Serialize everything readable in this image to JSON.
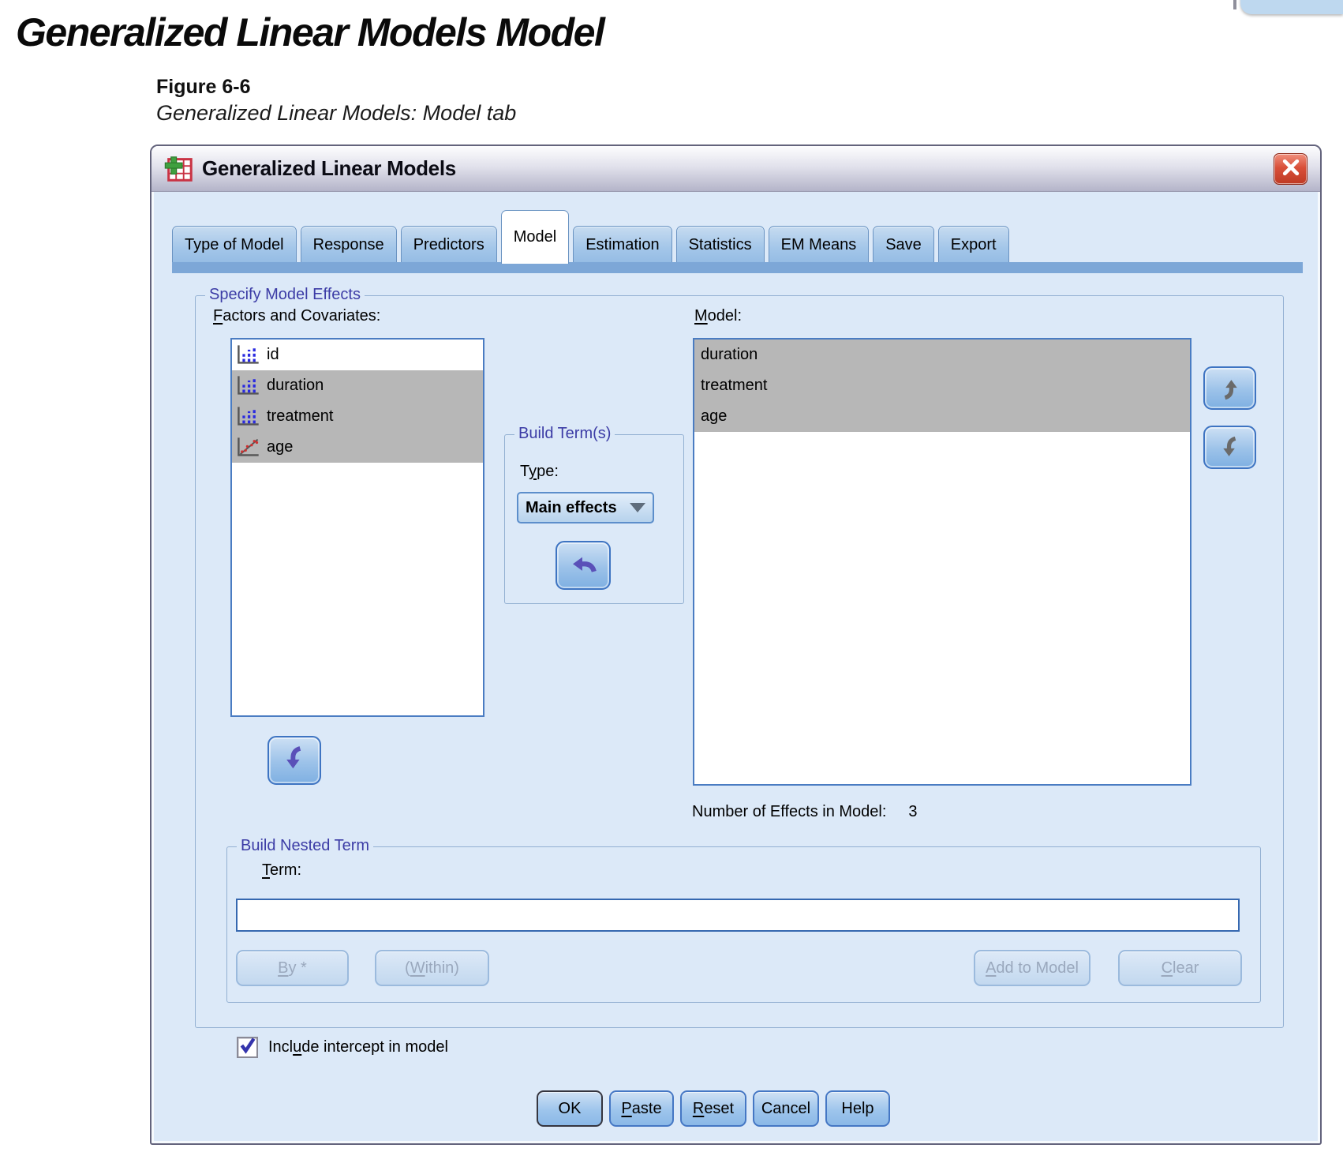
{
  "page": {
    "heading": "Generalized Linear Models Model",
    "figure_label": "Figure 6-6",
    "figure_caption": "Generalized Linear Models: Model tab"
  },
  "dialog": {
    "title": "Generalized Linear Models",
    "tabs": [
      {
        "label": "Type of Model",
        "active": false
      },
      {
        "label": "Response",
        "active": false
      },
      {
        "label": "Predictors",
        "active": false
      },
      {
        "label": "Model",
        "active": true
      },
      {
        "label": "Estimation",
        "active": false
      },
      {
        "label": "Statistics",
        "active": false
      },
      {
        "label": "EM Means",
        "active": false
      },
      {
        "label": "Save",
        "active": false
      },
      {
        "label": "Export",
        "active": false
      }
    ],
    "group_specify": "Specify Model Effects",
    "factors_label": {
      "pre": "",
      "key": "F",
      "post": "actors and Covariates:"
    },
    "factors": [
      {
        "name": "id",
        "type": "factor",
        "selected": false
      },
      {
        "name": "duration",
        "type": "factor",
        "selected": true
      },
      {
        "name": "treatment",
        "type": "factor",
        "selected": true
      },
      {
        "name": "age",
        "type": "covariate",
        "selected": true
      }
    ],
    "build_terms": {
      "group": "Build Term(s)",
      "type_label": {
        "pre": "T",
        "key": "y",
        "post": "pe:"
      },
      "type_value": "Main effects"
    },
    "model_label": {
      "pre": "",
      "key": "M",
      "post": "odel:"
    },
    "model_items": [
      "duration",
      "treatment",
      "age"
    ],
    "effects_count_label": "Number of Effects in Model:",
    "effects_count": "3",
    "nested": {
      "group": "Build Nested Term",
      "term_label": {
        "pre": "",
        "key": "T",
        "post": "erm:"
      },
      "term_value": "",
      "by": {
        "pre": "",
        "key": "B",
        "post": "y *"
      },
      "within": {
        "pre": "(",
        "key": "W",
        "post": "ithin)"
      },
      "add": {
        "pre": "",
        "key": "A",
        "post": "dd to Model"
      },
      "clear": {
        "pre": "",
        "key": "C",
        "post": "lear"
      }
    },
    "intercept": {
      "checked": true,
      "label": {
        "pre": "Incl",
        "key": "u",
        "post": "de intercept in model"
      }
    },
    "buttons": {
      "ok": "OK",
      "paste": {
        "pre": "",
        "key": "P",
        "post": "aste"
      },
      "reset": {
        "pre": "",
        "key": "R",
        "post": "eset"
      },
      "cancel": "Cancel",
      "help": "Help"
    }
  },
  "icons": {
    "close": "x-cross",
    "dialog_icon": "spss-grid-plus",
    "factor": "blue-bar-chart",
    "covariate": "scatter-trend-line",
    "dropdown_arrow": "triangle-down",
    "move_left": "curved-arrow-left",
    "move_down": "curved-arrow-down",
    "move_up": "curved-arrow-up",
    "check": "checkmark"
  },
  "colors": {
    "dialog_bg": "#dce9f8",
    "tab_strip": "#7da7d7",
    "selection_gray": "#b7b7b7",
    "group_label": "#3c3ca6",
    "list_border": "#4a7cc2",
    "close_red": "#c83a24",
    "arrow_purple": "#5a50b8",
    "arrow_gray": "#6a6a6a"
  }
}
